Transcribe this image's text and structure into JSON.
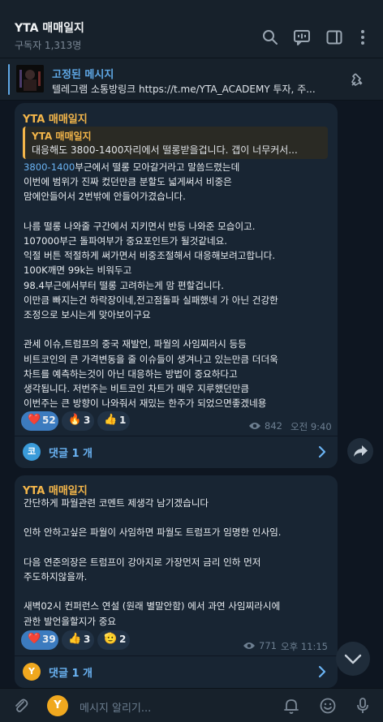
{
  "channel": {
    "title": "YTA 매매일지",
    "subscribers": "구독자 1,313명"
  },
  "header_icons": [
    "search-icon",
    "live-chat-icon",
    "sidebar-toggle-icon",
    "more-vertical-icon"
  ],
  "pinned": {
    "title": "고정된 메시지",
    "text": "텔레그램 소통방링크 https://t.me/YTA_ACADEMY 투자, 주..."
  },
  "messages": [
    {
      "author": "YTA 매매일지",
      "quote": {
        "author": "YTA 매매일지",
        "text": "대응해도 3800-1400자리에서 떨롱받을겁니다. 갭이 너무커서..."
      },
      "link_text": "3800-1400",
      "body_first_line_rest": "부근에서 떨롱 모아갈거라고 말씀드렸는데",
      "body": "이번에 범위가 진짜 컸던만큼 분할도 넓게써서 비중은\n맘에안들어서 2번밖에 안들어가겼습니다.\n\n나름 떨롱 나와줄 구간에서 지키면서 반등 나와준 모습이고.\n107000부근 돌파여부가 중요포인트가 될것같네요.\n익절 버튼 적절하게 써가면서 비중조절해서 대응해보려고합니다.\n100K깨면 99k는 비워두고\n98.4부근에서부터 떨롱 고려하는게 맘 편할겁니다.\n이만큼 빠지는건 하락장이네,전고점돌파 실패했네 가 아닌 건강한\n조정으로 보시는게 맞아보이구요\n\n관세 이슈,트럼프의 중국 재발언, 파월의 사임찌라시 등등\n비트코인의 큰 가격변동을 줄 이슈들이 생겨나고 있는만큼 더더욱\n차트를 예측하는것이 아닌 대응하는 방법이 중요하다고\n생각됩니다. 저번주는 비트코인 차트가 매우 지루했던만큼\n이번주는 큰 방향이 나와줘서 재밌는 한주가 되었으면좋겠네용",
      "reactions": [
        {
          "emoji": "❤️",
          "count": "52",
          "active": true
        },
        {
          "emoji": "🔥",
          "count": "3",
          "active": false
        },
        {
          "emoji": "👍",
          "count": "1",
          "active": false
        }
      ],
      "views": "842",
      "time": "오전 9:40",
      "comments": {
        "label": "댓글 1 개",
        "avatar_letter": "코",
        "avatar_color": "#3a9bd9"
      }
    },
    {
      "author": "YTA 매매일지",
      "body": "간단하게 파월관련 코멘트 제생각 남기겠습니다\n\n인하 안하고싶은 파월이 사임하면 파월도 트럼프가 임명한 인사임.\n\n다음 연준의장은 트럼프이 강아지로 가장먼저 금리 인하 먼저\n주도하지않을까.\n\n새벽02시 컨퍼런스 연설 (원래 별말안함) 에서 과연 사임찌라시에\n관한 발언을할지가 중요",
      "reactions": [
        {
          "emoji": "❤️",
          "count": "39",
          "active": true
        },
        {
          "emoji": "👍",
          "count": "3",
          "active": false
        },
        {
          "emoji": "🫡",
          "count": "2",
          "active": false
        }
      ],
      "views": "771",
      "time": "오후 11:15",
      "comments": {
        "label": "댓글 1 개",
        "avatar_letter": "Y",
        "avatar_color": "#f0a81f"
      }
    }
  ],
  "input": {
    "placeholder": "메시지 알리기...",
    "avatar_letter": "Y"
  },
  "colors": {
    "background": "#0e1621",
    "bubble": "#182533",
    "accent_blue": "#6ab3f3",
    "author_orange": "#f4b64a"
  }
}
